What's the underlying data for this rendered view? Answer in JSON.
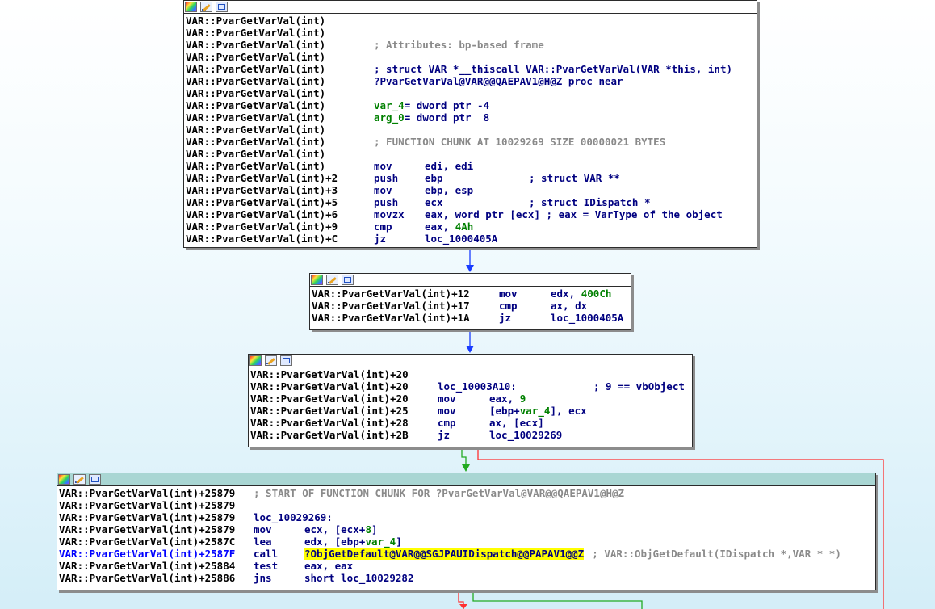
{
  "blocks": [
    {
      "head_style": "white",
      "lines": [
        {
          "addr": "VAR::PvarGetVarVal(int)"
        },
        {
          "addr": "VAR::PvarGetVarVal(int)"
        },
        {
          "addr": "VAR::PvarGetVarVal(int)",
          "comment": "; Attributes: bp-based frame"
        },
        {
          "addr": "VAR::PvarGetVarVal(int)"
        },
        {
          "addr": "VAR::PvarGetVarVal(int)",
          "comment": "; struct VAR *__thiscall VAR::PvarGetVarVal(VAR *this, int)",
          "comment_style": "navy"
        },
        {
          "addr": "VAR::PvarGetVarVal(int)",
          "label": "?PvarGetVarVal@VAR@@QAEPAV1@H@Z proc near"
        },
        {
          "addr": "VAR::PvarGetVarVal(int)"
        },
        {
          "addr": "VAR::PvarGetVarVal(int)",
          "varname": "var_4",
          "vardef": "= dword ptr -4"
        },
        {
          "addr": "VAR::PvarGetVarVal(int)",
          "varname": "arg_0",
          "vardef": "= dword ptr  8"
        },
        {
          "addr": "VAR::PvarGetVarVal(int)"
        },
        {
          "addr": "VAR::PvarGetVarVal(int)",
          "comment": "; FUNCTION CHUNK AT 10029269 SIZE 00000021 BYTES"
        },
        {
          "addr": "VAR::PvarGetVarVal(int)"
        },
        {
          "addr": "VAR::PvarGetVarVal(int)",
          "mn": "mov",
          "ops": "edi, edi"
        },
        {
          "addr": "VAR::PvarGetVarVal(int)+2",
          "mn": "push",
          "ops": "ebp",
          "tail": "; struct VAR **"
        },
        {
          "addr": "VAR::PvarGetVarVal(int)+3",
          "mn": "mov",
          "ops": "ebp, esp"
        },
        {
          "addr": "VAR::PvarGetVarVal(int)+5",
          "mn": "push",
          "ops": "ecx",
          "tail": "; struct IDispatch *"
        },
        {
          "addr": "VAR::PvarGetVarVal(int)+6",
          "mn": "movzx",
          "ops": "eax, word ptr [ecx] ; eax = VarType of the object"
        },
        {
          "addr": "VAR::PvarGetVarVal(int)+9",
          "mn": "cmp",
          "ops": "eax, ",
          "num": "4Ah"
        },
        {
          "addr": "VAR::PvarGetVarVal(int)+C",
          "mn": "jz",
          "ops": "loc_1000405A"
        }
      ]
    },
    {
      "head_style": "white",
      "lines": [
        {
          "addr": "VAR::PvarGetVarVal(int)+12",
          "mn": "mov",
          "ops": "edx, ",
          "num": "400Ch"
        },
        {
          "addr": "VAR::PvarGetVarVal(int)+17",
          "mn": "cmp",
          "ops": "ax, dx"
        },
        {
          "addr": "VAR::PvarGetVarVal(int)+1A",
          "mn": "jz",
          "ops": "loc_1000405A"
        }
      ]
    },
    {
      "head_style": "white",
      "lines": [
        {
          "addr": "VAR::PvarGetVarVal(int)+20"
        },
        {
          "addr": "VAR::PvarGetVarVal(int)+20",
          "label": "loc_10003A10:",
          "tail": "; 9 == vbObject"
        },
        {
          "addr": "VAR::PvarGetVarVal(int)+20",
          "mn": "mov",
          "ops": "eax, ",
          "num": "9"
        },
        {
          "addr": "VAR::PvarGetVarVal(int)+25",
          "mn": "mov",
          "ops": "[ebp+",
          "varref": "var_4",
          "ops2": "], ecx"
        },
        {
          "addr": "VAR::PvarGetVarVal(int)+28",
          "mn": "cmp",
          "ops": "ax, [ecx]"
        },
        {
          "addr": "VAR::PvarGetVarVal(int)+2B",
          "mn": "jz",
          "ops": "loc_10029269"
        }
      ]
    },
    {
      "head_style": "teal",
      "lines": [
        {
          "addr": "VAR::PvarGetVarVal(int)+25879",
          "comment": "; START OF FUNCTION CHUNK FOR ?PvarGetVarVal@VAR@@QAEPAV1@H@Z"
        },
        {
          "addr": "VAR::PvarGetVarVal(int)+25879"
        },
        {
          "addr": "VAR::PvarGetVarVal(int)+25879",
          "label": "loc_10029269:"
        },
        {
          "addr": "VAR::PvarGetVarVal(int)+25879",
          "mn": "mov",
          "ops": "ecx, [ecx+",
          "num": "8",
          "ops2": "]"
        },
        {
          "addr": "VAR::PvarGetVarVal(int)+2587C",
          "mn": "lea",
          "ops": "edx, [ebp+",
          "varref": "var_4",
          "ops2": "]"
        },
        {
          "addr": "VAR::PvarGetVarVal(int)+2587F",
          "current": true,
          "mn": "call",
          "hl": "?ObjGetDefault@VAR@@SGJPAUIDispatch@@PAPAV1@@Z",
          "tailgray": "; VAR::ObjGetDefault(IDispatch *,VAR * *)"
        },
        {
          "addr": "VAR::PvarGetVarVal(int)+25884",
          "mn": "test",
          "ops": "eax, eax"
        },
        {
          "addr": "VAR::PvarGetVarVal(int)+25886",
          "mn": "jns",
          "ops": "short loc_10029282"
        }
      ]
    }
  ],
  "colors": {
    "edge_normal": "#1a3cff",
    "edge_true": "#22aa22",
    "edge_false": "#ff3030",
    "highlight": "#ffff00"
  },
  "icons": [
    "color-palette-icon",
    "edit-pencil-icon",
    "graph-view-icon"
  ]
}
